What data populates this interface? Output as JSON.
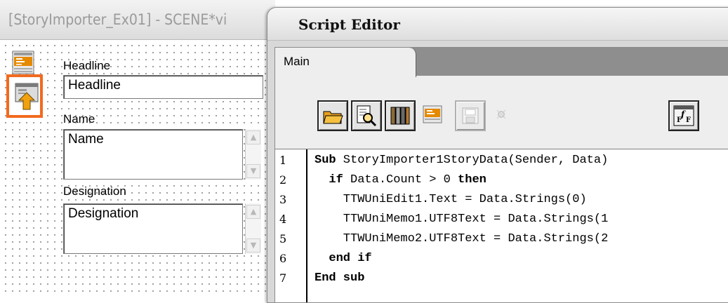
{
  "designer": {
    "title": "[StoryImporter_Ex01] - SCENE*vi",
    "labels": {
      "headline": "Headline",
      "name": "Name",
      "designation": "Designation"
    },
    "fields": {
      "headline": "Headline",
      "name": "Name",
      "designation": "Designation"
    },
    "tools": [
      "story-importer-icon",
      "import-icon"
    ],
    "highlight_color": "#f26a1f"
  },
  "editor": {
    "title": "Script Editor",
    "tabs": [
      {
        "label": "Main",
        "active": true
      }
    ],
    "toolbar": [
      "open-folder-icon",
      "search-icon",
      "library-icon",
      "component-icon",
      "save-icon",
      "disabled-icon",
      "functions-icon"
    ],
    "line_numbers": [
      "1",
      "2",
      "3",
      "4",
      "5",
      "6",
      "7"
    ],
    "code": [
      {
        "kw": "Sub",
        "rest": " StoryImporter1StoryData(Sender, Data)"
      },
      {
        "pre": "  ",
        "kw": "if",
        "mid": " Data.Count > 0 ",
        "kw2": "then"
      },
      {
        "text": "    TTWUniEdit1.Text = Data.Strings(0)"
      },
      {
        "text": "    TTWUniMemo1.UTF8Text = Data.Strings(1"
      },
      {
        "text": "    TTWUniMemo2.UTF8Text = Data.Strings(2"
      },
      {
        "pre": "  ",
        "kw": "end if"
      },
      {
        "kw": "End sub"
      }
    ]
  }
}
